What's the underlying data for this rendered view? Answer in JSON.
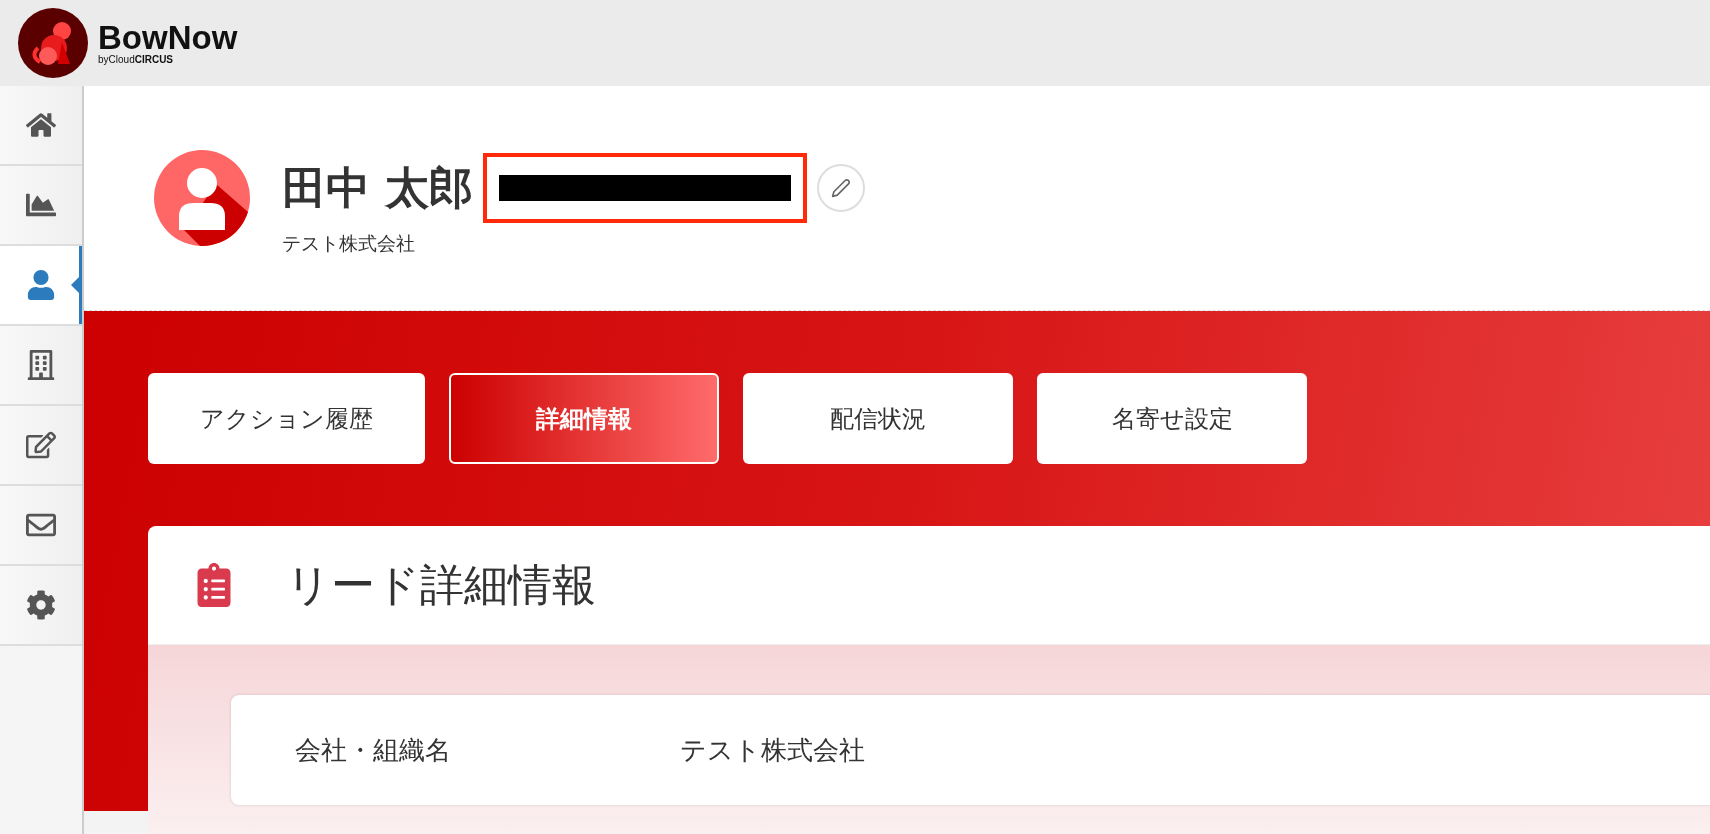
{
  "header": {
    "brand": "BowNow",
    "tagline": "byCloud**CIRCUS**"
  },
  "sidebar": {
    "items": [
      {
        "kind": "home",
        "selected": false
      },
      {
        "kind": "chart",
        "selected": false
      },
      {
        "kind": "person",
        "selected": true
      },
      {
        "kind": "building",
        "selected": false
      },
      {
        "kind": "edit",
        "selected": false
      },
      {
        "kind": "mail",
        "selected": false
      },
      {
        "kind": "settings",
        "selected": false
      }
    ]
  },
  "profile": {
    "name": "田中 太郎",
    "email_redacted": true,
    "company": "テスト株式会社"
  },
  "tabs": [
    {
      "label": "アクション履歴",
      "selected": false
    },
    {
      "label": "詳細情報",
      "selected": true
    },
    {
      "label": "配信状況",
      "selected": false
    },
    {
      "label": "名寄せ設定",
      "selected": false
    }
  ],
  "detail_card": {
    "title": "リード詳細情報",
    "rows": [
      {
        "label": "会社・組織名",
        "value": "テスト株式会社"
      }
    ]
  }
}
